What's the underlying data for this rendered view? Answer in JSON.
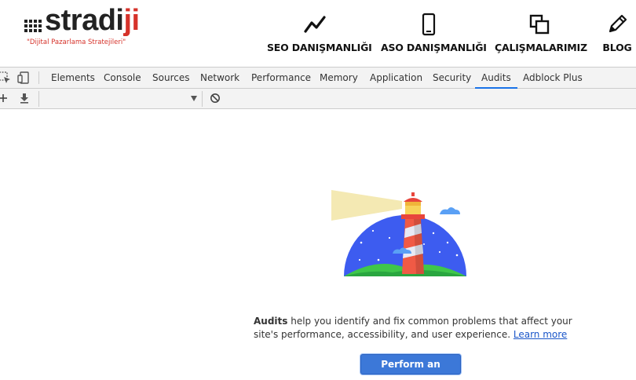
{
  "site": {
    "logo_text_main": "stradi",
    "logo_text_accent": "ji",
    "tagline": "\"Dijital Pazarlama Stratejileri\"",
    "nav": [
      {
        "label": "SEO DANIŞMANLIĞI",
        "icon": "trend-line-icon"
      },
      {
        "label": "ASO DANIŞMANLIĞI",
        "icon": "smartphone-icon"
      },
      {
        "label": "ÇALIŞMALARIMIZ",
        "icon": "copy-windows-icon"
      },
      {
        "label": "BLOG",
        "icon": "pencil-icon"
      }
    ]
  },
  "devtools": {
    "tabs": [
      "Elements",
      "Console",
      "Sources",
      "Network",
      "Performance",
      "Memory",
      "Application",
      "Security",
      "Audits",
      "Adblock Plus"
    ],
    "active_tab": "Audits",
    "toolbar": {
      "select_value": ""
    },
    "audits": {
      "description_bold": "Audits",
      "description_text": " help you identify and fix common problems that affect your site's performance, accessibility, and user experience. ",
      "learn_more": "Learn more",
      "button_label": "Perform an audit..."
    }
  },
  "colors": {
    "accent": "#1a73e8",
    "brand_red": "#d6322a",
    "button_blue": "#3c78d8"
  }
}
